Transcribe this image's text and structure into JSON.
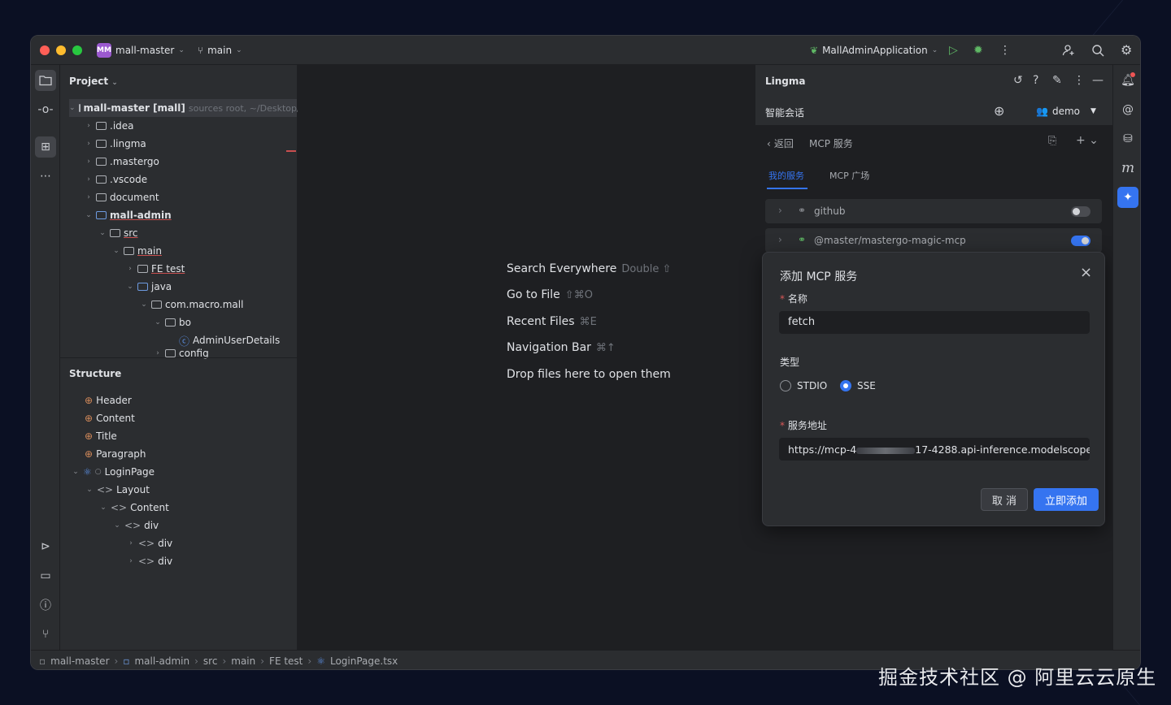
{
  "titlebar": {
    "project_badge": "MM",
    "project_name": "mall-master",
    "branch": "main",
    "run_config": "MallAdminApplication"
  },
  "project_panel": {
    "title": "Project",
    "root_name": "mall-master [mall]",
    "root_hint": "sources root, ~/Desktop/",
    "items": [
      {
        "label": ".idea"
      },
      {
        "label": ".lingma"
      },
      {
        "label": ".mastergo"
      },
      {
        "label": ".vscode"
      },
      {
        "label": "document"
      },
      {
        "label": "mall-admin"
      },
      {
        "label": "src"
      },
      {
        "label": "main"
      },
      {
        "label": "FE test"
      },
      {
        "label": "java"
      },
      {
        "label": "com.macro.mall"
      },
      {
        "label": "bo"
      },
      {
        "label": "AdminUserDetails"
      },
      {
        "label": "config"
      }
    ]
  },
  "structure_panel": {
    "title": "Structure",
    "items": [
      {
        "label": "Header"
      },
      {
        "label": "Content"
      },
      {
        "label": "Title"
      },
      {
        "label": "Paragraph"
      },
      {
        "label": "LoginPage"
      },
      {
        "label": "Layout"
      },
      {
        "label": "Content"
      },
      {
        "label": "div"
      },
      {
        "label": "div"
      },
      {
        "label": "div"
      }
    ]
  },
  "editor_hints": [
    {
      "label": "Search Everywhere",
      "shortcut": "Double ⇧"
    },
    {
      "label": "Go to File",
      "shortcut": "⇧⌘O"
    },
    {
      "label": "Recent Files",
      "shortcut": "⌘E"
    },
    {
      "label": "Navigation Bar",
      "shortcut": "⌘↑"
    },
    {
      "label": "Drop files here to open them",
      "shortcut": ""
    }
  ],
  "lingma": {
    "title": "Lingma",
    "session_label": "智能会话",
    "user": "demo",
    "back_label": "返回",
    "page_title": "MCP 服务",
    "tabs": [
      {
        "label": "我的服务"
      },
      {
        "label": "MCP 广场"
      }
    ],
    "services": [
      {
        "name": "github",
        "enabled": false
      },
      {
        "name": "@master/mastergo-magic-mcp",
        "enabled": true
      }
    ]
  },
  "dialog": {
    "title": "添加 MCP 服务",
    "name_label": "名称",
    "name_value": "fetch",
    "type_label": "类型",
    "type_options": [
      "STDIO",
      "SSE"
    ],
    "type_selected": "SSE",
    "url_label": "服务地址",
    "url_value_start": "https://mcp-4",
    "url_value_end": "17-4288.api-inference.modelscope",
    "cancel_label": "取 消",
    "submit_label": "立即添加"
  },
  "statusbar": {
    "crumbs": [
      "mall-master",
      "mall-admin",
      "src",
      "main",
      "FE test",
      "LoginPage.tsx"
    ]
  },
  "watermark": "掘金技术社区 @ 阿里云云原生",
  "colors": {
    "accent": "#3574f0",
    "window_bg": "#1e1f22",
    "panel_bg": "#2b2d30"
  }
}
